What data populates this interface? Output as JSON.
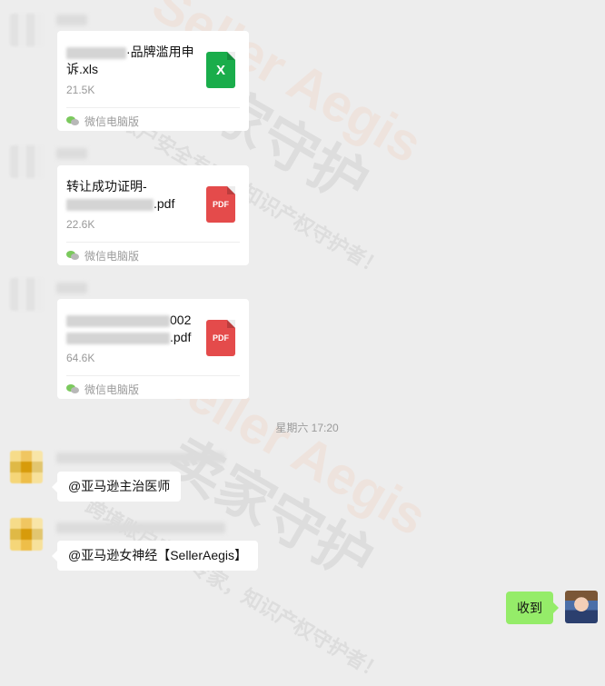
{
  "watermark": {
    "brand_en": "Seller Aegis",
    "brand_cn": "卖家守护",
    "slogan": "跨境账户安全专家，知识产权守护者！"
  },
  "messages": [
    {
      "type": "file",
      "file_name_line1": "·品牌滥用申",
      "file_name_line2": "诉.xls",
      "file_size": "21.5K",
      "file_type": "xls",
      "icon_label": "X",
      "footer": "微信电脑版"
    },
    {
      "type": "file",
      "file_name_line1": "转让成功证明-",
      "file_name_line2": ".pdf",
      "file_size": "22.6K",
      "file_type": "pdf",
      "icon_label": "PDF",
      "footer": "微信电脑版"
    },
    {
      "type": "file",
      "file_name_line1": "002",
      "file_name_line2": ".pdf",
      "file_size": "64.6K",
      "file_type": "pdf",
      "icon_label": "PDF",
      "footer": "微信电脑版"
    }
  ],
  "time_separator": "星期六 17:20",
  "text_messages": [
    {
      "text": "@亚马逊主治医师"
    },
    {
      "text": "@亚马逊女神经【SellerAegis】"
    }
  ],
  "my_message": {
    "text": "收到"
  },
  "colors": {
    "background": "#ededed",
    "xls_icon": "#1aad4b",
    "pdf_icon": "#e44b4b",
    "my_bubble": "#95ec69"
  }
}
